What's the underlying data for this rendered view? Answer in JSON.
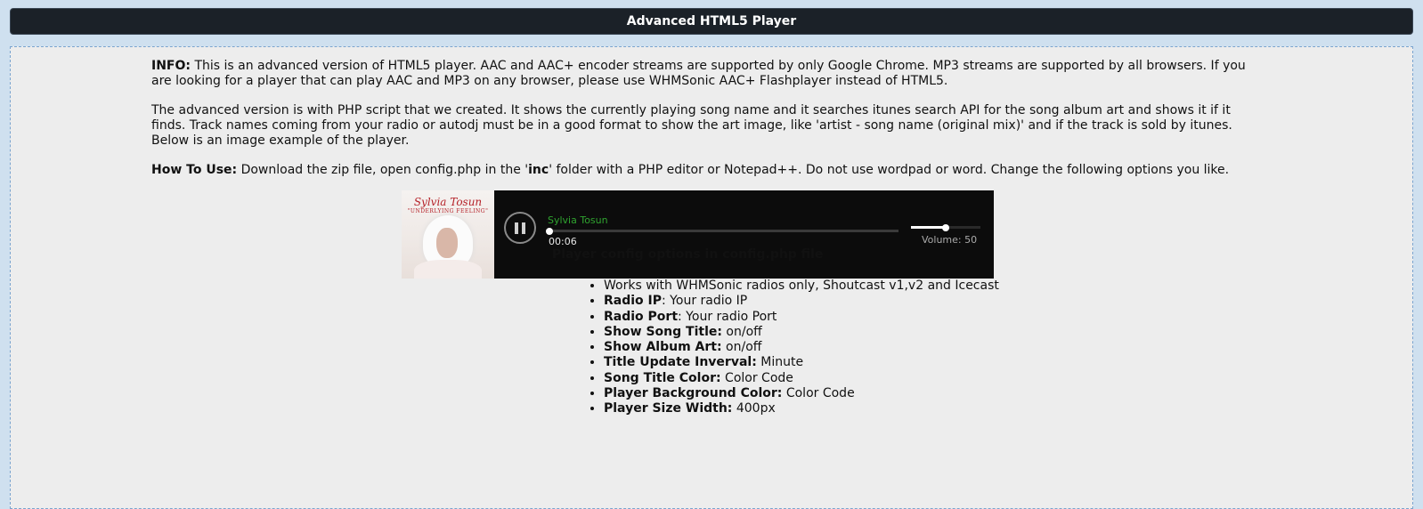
{
  "header": {
    "title": "Advanced HTML5 Player"
  },
  "info": {
    "p1_label": "INFO:",
    "p1_text": " This is an advanced version of HTML5 player. AAC and AAC+ encoder streams are supported by only Google Chrome. MP3 streams are supported by all browsers. If you are looking for a player that can play AAC and MP3 on any browser, please use WHMSonic AAC+ Flashplayer instead of HTML5.",
    "p2_text": "The advanced version is with PHP script that we created. It shows the currently playing song name and it searches itunes search API for the song album art and shows it if it finds. Track names coming from your radio or autodj must be in a good format to show the art image, like 'artist - song name (original mix)' and if the track is sold by itunes. Below is an image example of the player.",
    "p3_label": "How To Use:",
    "p3_text_a": " Download the zip file, open config.php in the '",
    "p3_bold": "inc",
    "p3_text_b": "' folder with a PHP editor or Notepad++. Do not use wordpad or word. Change the following options you like."
  },
  "player": {
    "album_name": "Sylvia Tosun",
    "album_subtitle": "\"UNDERLYING FEELING\"",
    "song_title": "Sylvia Tosun",
    "time": "00:06",
    "progress_fraction": 0.0,
    "volume_label": "Volume: 50",
    "volume_fraction": 0.5,
    "pause_icon": "pause-icon",
    "colors": {
      "song": "#2fa32f",
      "background": "#0c0c0c"
    }
  },
  "config": {
    "title": "Player config options in config.php file",
    "options": [
      {
        "label": "",
        "value": "Works with WHMSonic radios only, Shoutcast v1,v2 and Icecast"
      },
      {
        "label": "Radio IP",
        "value": ": Your radio IP"
      },
      {
        "label": "Radio Port",
        "value": ": Your radio Port"
      },
      {
        "label": "Show Song Title:",
        "value": " on/off"
      },
      {
        "label": "Show Album Art:",
        "value": " on/off"
      },
      {
        "label": "Title Update Inverval:",
        "value": " Minute"
      },
      {
        "label": "Song Title Color:",
        "value": " Color Code"
      },
      {
        "label": "Player Background Color:",
        "value": " Color Code"
      },
      {
        "label": "Player Size Width:",
        "value": " 400px"
      }
    ]
  }
}
